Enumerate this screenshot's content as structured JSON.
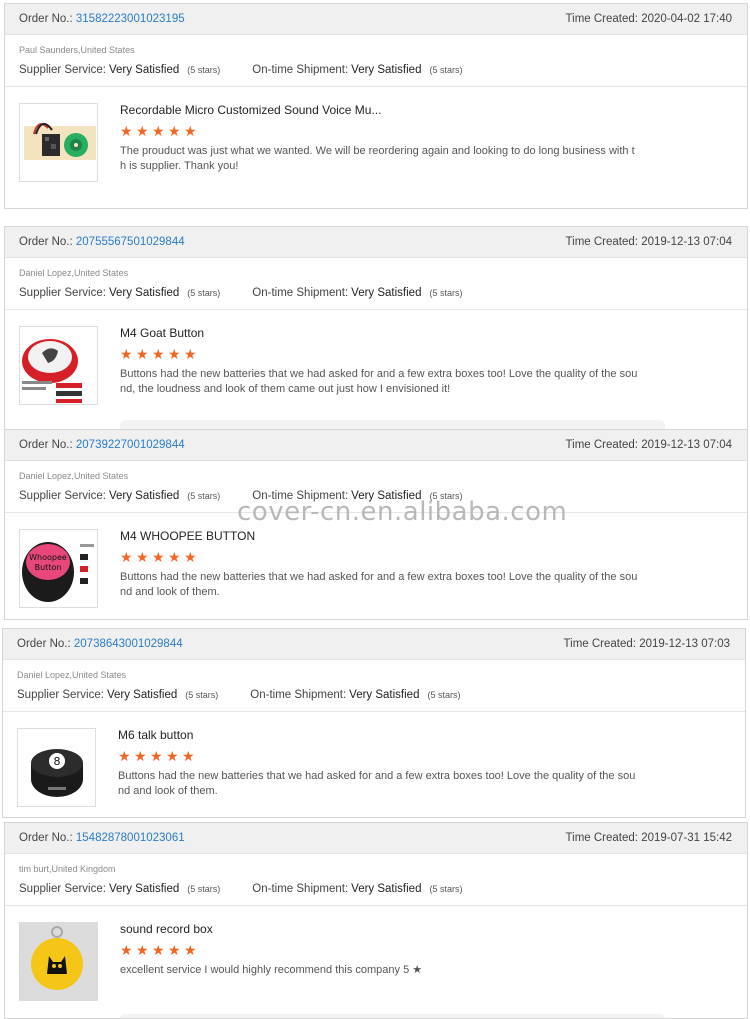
{
  "labels": {
    "order_no": "Order No.:",
    "time_created": "Time Created:",
    "supplier_service": "Supplier Service:",
    "ontime_shipment": "On-time Shipment:"
  },
  "star_color": "#f26522",
  "link_color": "#2a7cc7",
  "watermark": "cover-cn.en.alibaba.com",
  "reviews": [
    {
      "order_no": "31582223001023195",
      "time_created": "2020-04-02 17:40",
      "buyer": "Paul Saunders,United States",
      "supplier_service": "Very Satisfied",
      "supplier_stars": "(5 stars)",
      "shipment": "Very Satisfied",
      "shipment_stars": "(5 stars)",
      "product": "Recordable Micro Customized Sound Voice Mu...",
      "rating": 5,
      "text": "The prouduct was just what we wanted. We will be reordering again and looking to do long business with th is supplier. Thank you!",
      "image_icon": "sound-module-board"
    },
    {
      "order_no": "20755567501029844",
      "time_created": "2019-12-13 07:04",
      "buyer": "Daniel Lopez,United States",
      "supplier_service": "Very Satisfied",
      "supplier_stars": "(5 stars)",
      "shipment": "Very Satisfied",
      "shipment_stars": "(5 stars)",
      "product": "M4 Goat Button",
      "rating": 5,
      "text": "Buttons had the new batteries that we had asked for and a few extra boxes too! Love the quality of the sou nd, the loudness and look of them came out just how I envisioned it!",
      "image_icon": "goat-button"
    },
    {
      "order_no": "20739227001029844",
      "time_created": "2019-12-13 07:04",
      "buyer": "Daniel Lopez,United States",
      "supplier_service": "Very Satisfied",
      "supplier_stars": "(5 stars)",
      "shipment": "Very Satisfied",
      "shipment_stars": "(5 stars)",
      "product": "M4 WHOOPEE BUTTON",
      "rating": 5,
      "text": "Buttons had the new batteries that we had asked for and a few extra boxes too! Love the quality of the sou nd and look of them.",
      "image_icon": "whoopee-button"
    },
    {
      "order_no": "20738643001029844",
      "time_created": "2019-12-13 07:03",
      "buyer": "Daniel Lopez,United States",
      "supplier_service": "Very Satisfied",
      "supplier_stars": "(5 stars)",
      "shipment": "Very Satisfied",
      "shipment_stars": "(5 stars)",
      "product": "M6 talk button",
      "rating": 5,
      "text": "Buttons had the new batteries that we had asked for and a few extra boxes too! Love the quality of the sou nd and look of them.",
      "image_icon": "eight-ball-button"
    },
    {
      "order_no": "15482878001023061",
      "time_created": "2019-07-31 15:42",
      "buyer": "tim burt,United Kingdom",
      "supplier_service": "Very Satisfied",
      "supplier_stars": "(5 stars)",
      "shipment": "Very Satisfied",
      "shipment_stars": "(5 stars)",
      "product": "sound record box",
      "rating": 5,
      "text": "excellent service I would highly recommend this company 5",
      "image_icon": "cat-keychain"
    }
  ]
}
